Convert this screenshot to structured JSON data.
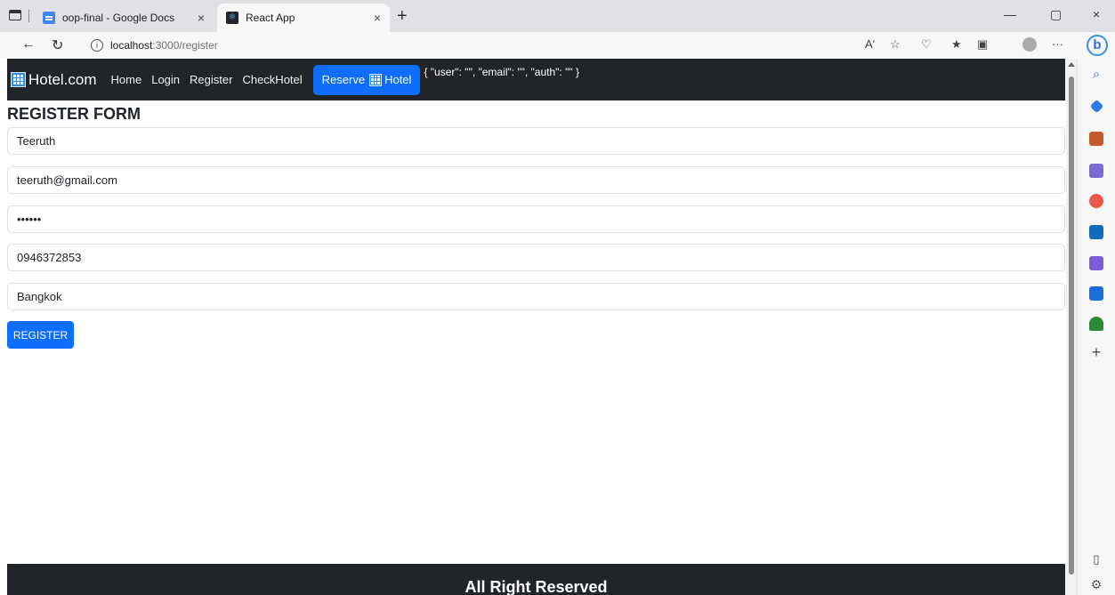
{
  "browser": {
    "tabs": [
      {
        "title": "oop-final - Google Docs",
        "close": "×"
      },
      {
        "title": "React App",
        "close": "×"
      }
    ],
    "new_tab": "+",
    "window_controls": {
      "minimize": "—",
      "restore": "▢",
      "close": "×"
    },
    "address": {
      "host": "localhost",
      "path": ":3000/register"
    },
    "toolbar": {
      "read_aloud": "Aʹ",
      "more": "···"
    },
    "bing_label": "b"
  },
  "nav": {
    "brand": "Hotel.com",
    "links": [
      "Home",
      "Login",
      "Register",
      "CheckHotel"
    ],
    "reserve_prefix": "Reserve",
    "reserve_suffix": "Hotel",
    "user_state": "{ \"user\": \"\", \"email\": \"\", \"auth\": \"\" }"
  },
  "form": {
    "title": "REGISTER FORM",
    "name_value": "Teeruth",
    "email_value": "teeruth@gmail.com",
    "password_value": "123456",
    "phone_value": "0946372853",
    "address_value": "Bangkok",
    "submit_label": "REGISTER"
  },
  "footer": {
    "text": "All Right Reserved"
  },
  "colors": {
    "primary": "#0d6efd",
    "navbar": "#212529"
  }
}
